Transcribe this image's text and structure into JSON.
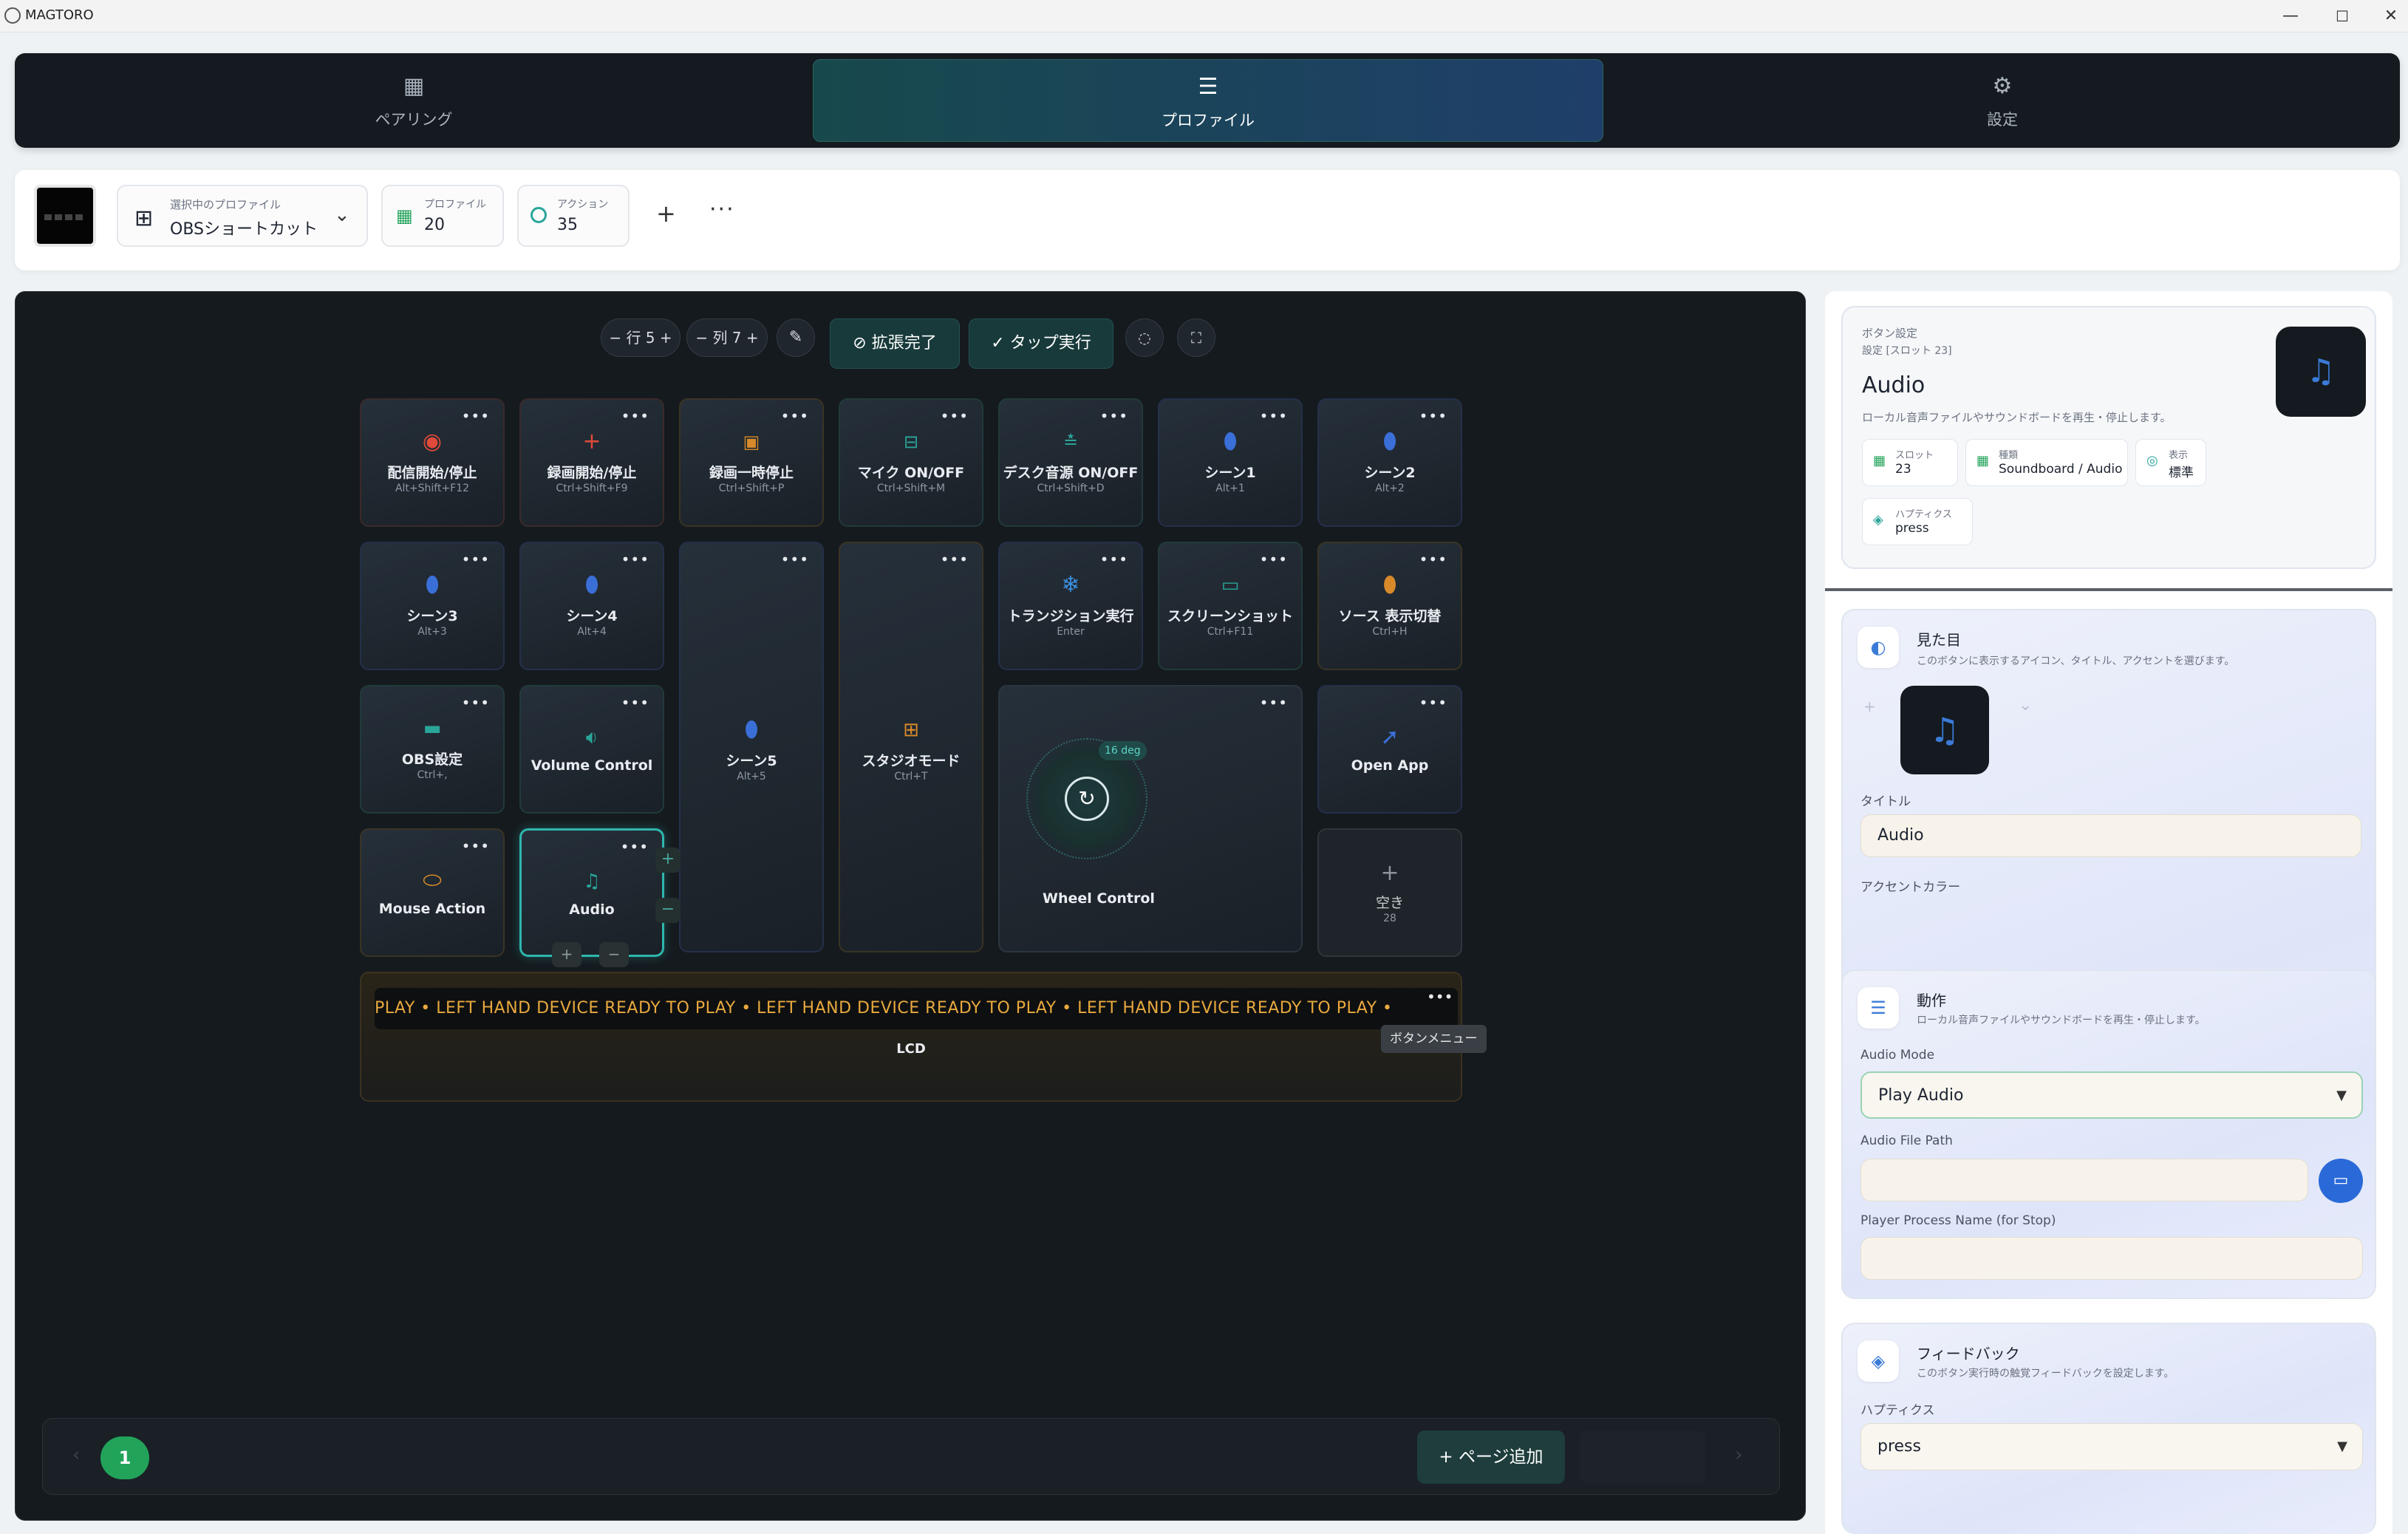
{
  "window": {
    "title": "MAGTORO"
  },
  "nav": {
    "tabs": [
      {
        "label": "ペアリング",
        "icon": "qr-icon"
      },
      {
        "label": "プロファイル",
        "icon": "sliders-icon"
      },
      {
        "label": "設定",
        "icon": "gear-icon"
      }
    ]
  },
  "profile_bar": {
    "selected_label": "選択中のプロファイル",
    "selected_value": "OBSショートカット",
    "profiles_label": "プロファイル",
    "profiles_value": "20",
    "actions_label": "アクション",
    "actions_value": "35"
  },
  "toolbar": {
    "rows": "行 5",
    "cols": "列 7",
    "expand_done": "拡張完了",
    "tap_exec": "タップ実行"
  },
  "tiles": [
    {
      "title": "配信開始/停止",
      "shortcut": "Alt+Shift+F12"
    },
    {
      "title": "録画開始/停止",
      "shortcut": "Ctrl+Shift+F9"
    },
    {
      "title": "録画一時停止",
      "shortcut": "Ctrl+Shift+P"
    },
    {
      "title": "マイク ON/OFF",
      "shortcut": "Ctrl+Shift+M"
    },
    {
      "title": "デスク音源 ON/OFF",
      "shortcut": "Ctrl+Shift+D"
    },
    {
      "title": "シーン1",
      "shortcut": "Alt+1"
    },
    {
      "title": "シーン2",
      "shortcut": "Alt+2"
    },
    {
      "title": "シーン3",
      "shortcut": "Alt+3"
    },
    {
      "title": "シーン4",
      "shortcut": "Alt+4"
    },
    {
      "title": "シーン5",
      "shortcut": "Alt+5"
    },
    {
      "title": "スタジオモード",
      "shortcut": "Ctrl+T"
    },
    {
      "title": "トランジション実行",
      "shortcut": "Enter"
    },
    {
      "title": "スクリーンショット",
      "shortcut": "Ctrl+F11"
    },
    {
      "title": "ソース 表示切替",
      "shortcut": "Ctrl+H"
    },
    {
      "title": "OBS設定",
      "shortcut": "Ctrl+,"
    },
    {
      "title": "Volume Control",
      "shortcut": ""
    },
    {
      "title": "Wheel Control",
      "shortcut": "",
      "angle": "16 deg"
    },
    {
      "title": "Open App",
      "shortcut": ""
    },
    {
      "title": "Mouse Action",
      "shortcut": ""
    },
    {
      "title": "Audio",
      "shortcut": ""
    },
    {
      "title": "空き",
      "shortcut": "28"
    }
  ],
  "lcd": {
    "ticker": "PLAY  •  LEFT HAND DEVICE   READY TO PLAY  •  LEFT HAND DEVICE   READY TO PLAY  •  LEFT HAND DEVICE   READY TO PLAY  •",
    "label": "LCD",
    "tooltip": "ボタンメニュー"
  },
  "pager": {
    "current_page": "1",
    "add_page": "ページ追加"
  },
  "button_settings": {
    "section": "ボタン設定",
    "slot_ref": "設定 [スロット 23]",
    "name": "Audio",
    "description": "ローカル音声ファイルやサウンドボードを再生・停止します。",
    "meta": [
      {
        "label": "スロット",
        "value": "23"
      },
      {
        "label": "種類",
        "value": "Soundboard / Audio"
      },
      {
        "label": "表示",
        "value": "標準"
      },
      {
        "label": "ハプティクス",
        "value": "press"
      }
    ]
  },
  "appearance": {
    "heading": "見た目",
    "description": "このボタンに表示するアイコン、タイトル、アクセントを選びます。",
    "title_label": "タイトル",
    "title_value": "Audio",
    "accent_label": "アクセントカラー",
    "accent_colors": [
      "#2aa59a",
      "#3b6fd8",
      "#2fa35f",
      "#e0a640",
      "#d9524a",
      "#7c5bd9",
      "#465160"
    ]
  },
  "action": {
    "heading": "動作",
    "description": "ローカル音声ファイルやサウンドボードを再生・停止します。",
    "mode_label": "Audio Mode",
    "mode_value": "Play Audio",
    "path_label": "Audio File Path",
    "path_value": "",
    "process_label": "Player Process Name (for Stop)",
    "process_value": ""
  },
  "feedback": {
    "heading": "フィードバック",
    "description": "このボタン実行時の触覚フィードバックを設定します。",
    "haptics_label": "ハプティクス",
    "haptics_value": "press"
  }
}
